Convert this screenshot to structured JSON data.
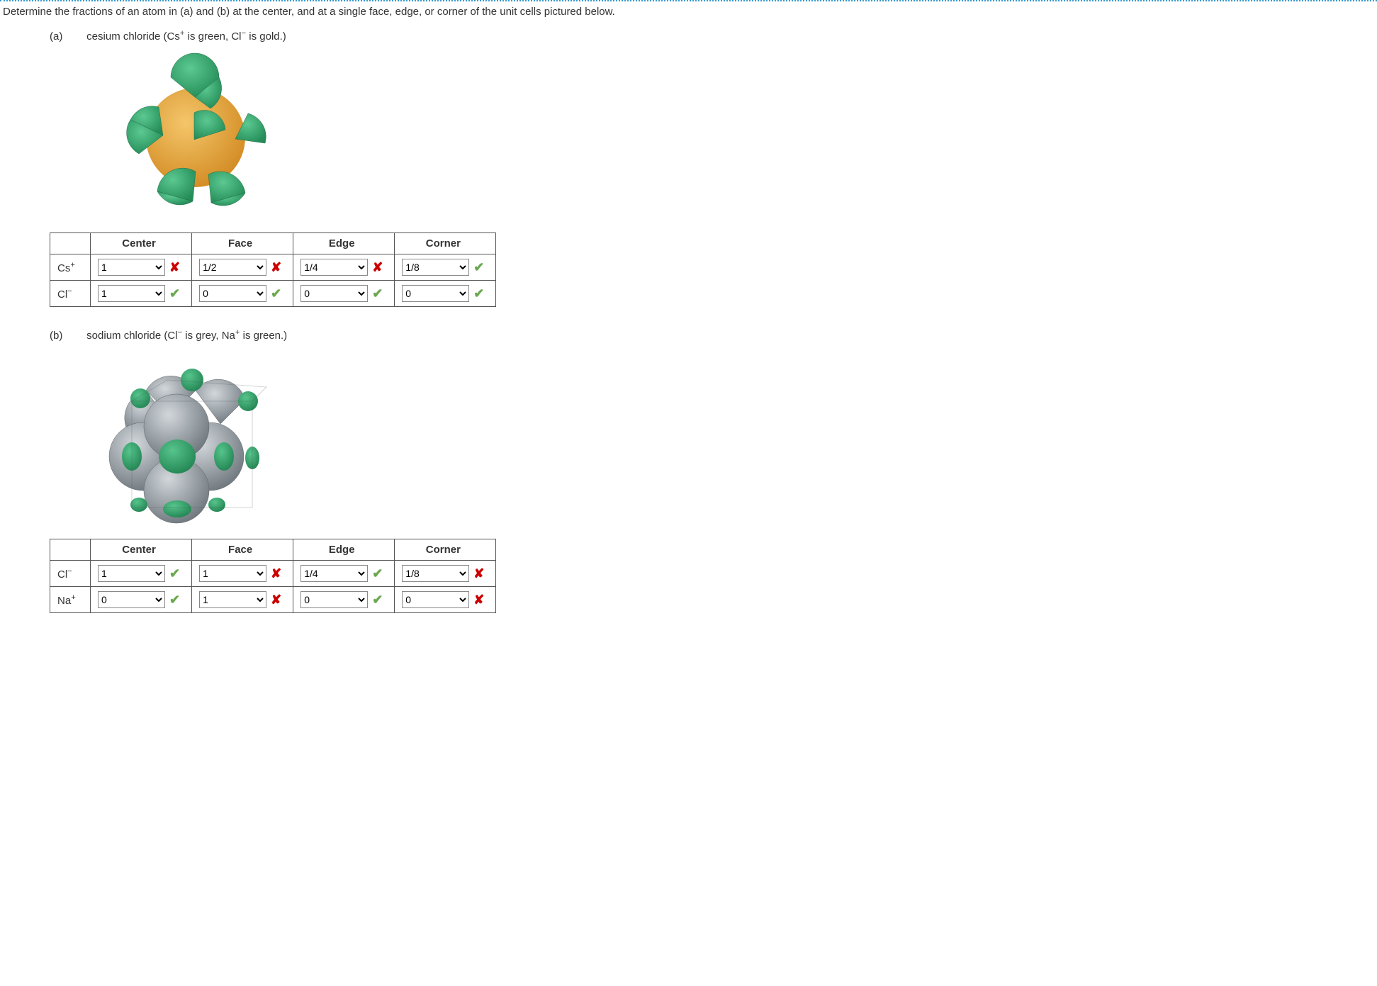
{
  "prompt": "Determine the fractions of an atom in (a) and (b) at the center, and at a single face, edge, or corner of the unit cells pictured below.",
  "parts": {
    "a": {
      "label": "(a)",
      "desc_pre": "cesium chloride (Cs",
      "desc_mid1": " is green, Cl",
      "desc_post": " is gold.)",
      "sup1": "+",
      "sup2": "−",
      "headers": {
        "c1": "Center",
        "c2": "Face",
        "c3": "Edge",
        "c4": "Corner"
      },
      "rows": [
        {
          "ion_base": "Cs",
          "ion_sup": "+",
          "cells": [
            {
              "value": "1",
              "status": "wrong"
            },
            {
              "value": "1/2",
              "status": "wrong"
            },
            {
              "value": "1/4",
              "status": "wrong"
            },
            {
              "value": "1/8",
              "status": "correct"
            }
          ]
        },
        {
          "ion_base": "Cl",
          "ion_sup": "−",
          "cells": [
            {
              "value": "1",
              "status": "correct"
            },
            {
              "value": "0",
              "status": "correct"
            },
            {
              "value": "0",
              "status": "correct"
            },
            {
              "value": "0",
              "status": "correct"
            }
          ]
        }
      ]
    },
    "b": {
      "label": "(b)",
      "desc_pre": "sodium chloride (Cl",
      "desc_mid1": " is grey, Na",
      "desc_post": " is green.)",
      "sup1": "−",
      "sup2": "+",
      "headers": {
        "c1": "Center",
        "c2": "Face",
        "c3": "Edge",
        "c4": "Corner"
      },
      "rows": [
        {
          "ion_base": "Cl",
          "ion_sup": "−",
          "cells": [
            {
              "value": "1",
              "status": "correct"
            },
            {
              "value": "1",
              "status": "wrong"
            },
            {
              "value": "1/4",
              "status": "correct"
            },
            {
              "value": "1/8",
              "status": "wrong"
            }
          ]
        },
        {
          "ion_base": "Na",
          "ion_sup": "+",
          "cells": [
            {
              "value": "0",
              "status": "correct"
            },
            {
              "value": "1",
              "status": "wrong"
            },
            {
              "value": "0",
              "status": "correct"
            },
            {
              "value": "0",
              "status": "wrong"
            }
          ]
        }
      ]
    }
  },
  "select_options": [
    "",
    "0",
    "1/8",
    "1/4",
    "1/2",
    "1"
  ],
  "marks": {
    "correct": "✔",
    "wrong": "✘"
  },
  "colors": {
    "green": "#3aae6f",
    "green_dark": "#2c8a57",
    "gold": "#e6a43c",
    "gold_dark": "#c2832a",
    "grey": "#a0a7ad",
    "grey_dark": "#7a8288"
  }
}
